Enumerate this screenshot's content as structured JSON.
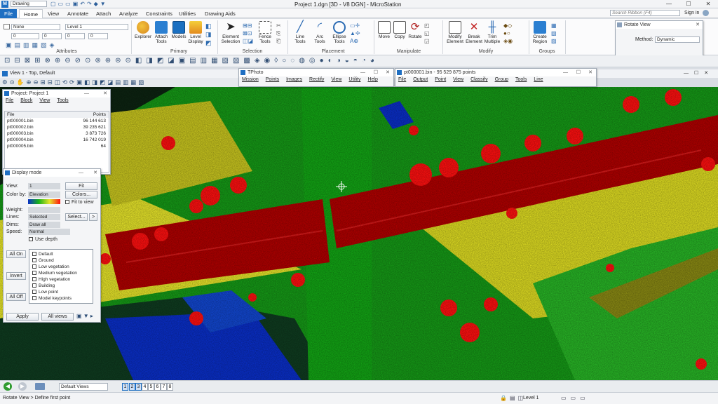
{
  "app": {
    "window_title": "Project 1.dgn [3D - V8 DGN] - MicroStation",
    "workflow": "Drawing",
    "search_placeholder": "Search Ribbon (F4)",
    "sign_in": "Sign in"
  },
  "tabs": [
    "File",
    "Home",
    "View",
    "Annotate",
    "Attach",
    "Analyze",
    "Constraints",
    "Utilities",
    "Drawing Aids"
  ],
  "ribbon": {
    "attributes": {
      "label": "Attributes",
      "color": "None",
      "level": "Level 1",
      "weight": "0",
      "style": "0",
      "w2": "0",
      "w3": "0"
    },
    "primary": {
      "label": "Primary",
      "buttons": [
        "Explorer",
        "Attach Tools",
        "Models",
        "Level Display"
      ]
    },
    "selection": {
      "label": "Selection",
      "buttons": [
        "Element Selection",
        "Fence Tools"
      ]
    },
    "placement": {
      "label": "Placement",
      "buttons": [
        "Line Tools",
        "Arc Tools",
        "Ellipse Tools"
      ]
    },
    "manipulate": {
      "label": "Manipulate",
      "buttons": [
        "Move",
        "Copy",
        "Rotate"
      ]
    },
    "modify": {
      "label": "Modify",
      "buttons": [
        "Modify Element",
        "Break Element",
        "Trim Multiple"
      ]
    },
    "groups": {
      "label": "Groups",
      "buttons": [
        "Create Region"
      ]
    }
  },
  "rotate_view": {
    "title": "Rotate View",
    "method_label": "Method:",
    "method_value": "Dynamic"
  },
  "view_title": "View 1 - Top, Default",
  "tphoto": {
    "title": "TPhoto",
    "menu": [
      "Mission",
      "Points",
      "Images",
      "Rectify",
      "View",
      "Utility",
      "Help"
    ]
  },
  "pointcloud_window": {
    "title": "pt000001.bin - 95 529 875 points",
    "menu": [
      "File",
      "Output",
      "Point",
      "View",
      "Classify",
      "Group",
      "Tools",
      "Line"
    ]
  },
  "project": {
    "title": "Project: Project 1",
    "menu": [
      "File",
      "Block",
      "View",
      "Tools"
    ],
    "columns": [
      "File",
      "Points"
    ],
    "rows": [
      {
        "file": "pt000001.bin",
        "points": "96 144 613"
      },
      {
        "file": "pt000002.bin",
        "points": "39 235 621"
      },
      {
        "file": "pt000003.bin",
        "points": "3 873 726"
      },
      {
        "file": "pt000004.bin",
        "points": "16 742 019"
      },
      {
        "file": "pt000005.bin",
        "points": "64"
      }
    ]
  },
  "display_mode": {
    "title": "Display mode",
    "view_label": "View:",
    "view_value": "1",
    "fit_button": "Fit",
    "color_by_label": "Color by:",
    "color_by_value": "Elevation",
    "colors_button": "Colors...",
    "fit_to_view": "Fit to view",
    "weight_label": "Weight:",
    "lines_label": "Lines:",
    "lines_value": "Selected",
    "select_button": "Select...",
    "arrow_button": ">",
    "dims_label": "Dims:",
    "dims_value": "Draw all",
    "speed_label": "Speed:",
    "speed_value": "Normal",
    "use_depth": "Use depth",
    "all_on": "All On",
    "invert": "Invert",
    "all_off": "All Off",
    "classes": [
      "Default",
      "Ground",
      "Low vegetation",
      "Medium vegetation",
      "High vegetation",
      "Building",
      "Low point",
      "Model keypoints"
    ],
    "apply": "Apply",
    "all_views": "All views"
  },
  "nav": {
    "views_label": "Default Views",
    "view_numbers": [
      "1",
      "2",
      "3",
      "4",
      "5",
      "6",
      "7",
      "8"
    ]
  },
  "status": {
    "prompt": "Rotate View > Define first point",
    "level": "Level 1"
  },
  "colors": {
    "accent": "#1f6fc2",
    "ground": "#1aa31a",
    "road": "#b30000",
    "vegetation_high": "#ff0000",
    "vegetation_low": "#f0ee10",
    "water": "#0a2fc8",
    "dark": "#0b1e10"
  }
}
